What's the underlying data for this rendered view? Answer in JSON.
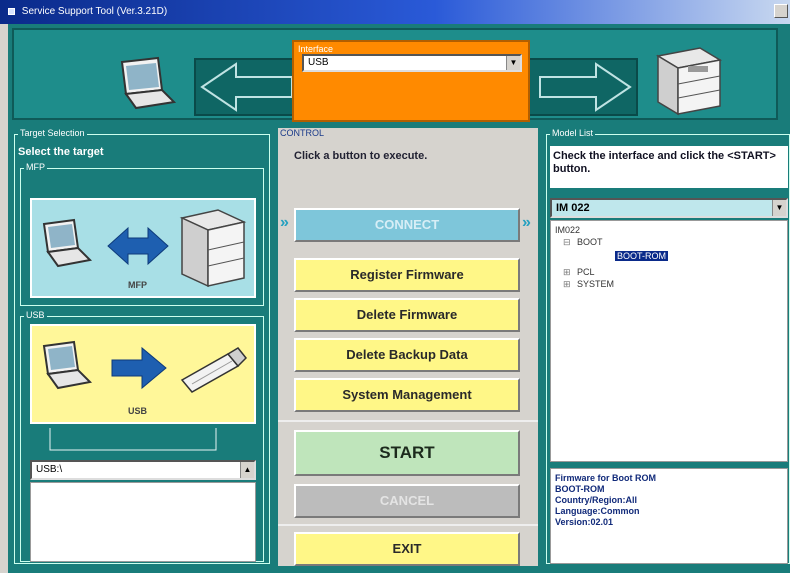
{
  "window": {
    "title": "Service Support Tool (Ver.3.21D)"
  },
  "interface": {
    "label": "Interface",
    "selected": "USB"
  },
  "target_selection": {
    "title": "Target Selection",
    "instruction": "Select the target",
    "mfp_group_label": "MFP",
    "mfp_caption": "MFP",
    "usb_group_label": "USB",
    "usb_caption": "USB",
    "usb_drive_selected": "USB:\\"
  },
  "control": {
    "title": "CONTROL",
    "instruction": "Click a button to execute.",
    "connect_label": "CONNECT",
    "register_label": "Register Firmware",
    "delete_firmware_label": "Delete Firmware",
    "delete_backup_label": "Delete Backup Data",
    "system_mgmt_label": "System Management",
    "start_label": "START",
    "cancel_label": "CANCEL",
    "exit_label": "EXIT"
  },
  "model_list": {
    "title": "Model List",
    "instruction": "Check the interface and click the <START> button.",
    "selected_model": "IM 022",
    "tree": {
      "root": "IM022",
      "boot": "BOOT",
      "boot_child": "BOOT-ROM",
      "pcl": "PCL",
      "system": "SYSTEM"
    },
    "info": {
      "line1": "Firmware for Boot ROM",
      "line2": "BOOT-ROM",
      "line3": "Country/Region:All",
      "line4": "Language:Common",
      "line5": "Version:02.01"
    }
  },
  "colors": {
    "panel_teal": "#197c7a",
    "interface_orange": "#ff8a00",
    "button_yellow": "#fff787",
    "start_green": "#bfe5bb",
    "connect_blue": "#7ec6da"
  }
}
